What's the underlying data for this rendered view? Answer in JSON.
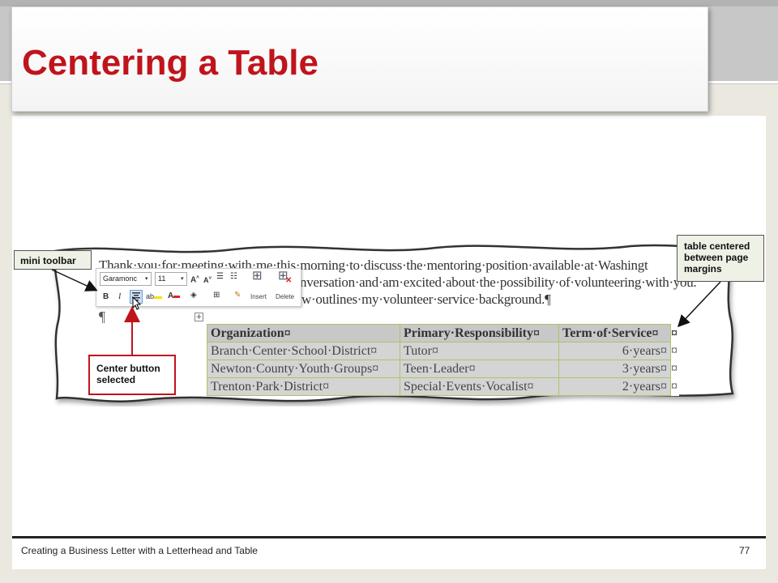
{
  "slide": {
    "title": "Centering a Table",
    "footer": "Creating a Business Letter with a Letterhead and Table",
    "page_number": "77"
  },
  "document": {
    "line1": "Thank·you·for·meeting·with·me·this·morning·to·discuss·the·mentoring·position·available·at·Washingt",
    "line2": "nversation·and·am·excited·about·the·possibility·of·volunteering·with·you.",
    "line3": "w·outlines·my·volunteer·service·background.¶",
    "pilcrow": "¶",
    "table_handle": "+",
    "table": {
      "headers": [
        "Organization¤",
        "Primary·Responsibility¤",
        "Term·of·Service¤",
        "¤"
      ],
      "rows": [
        [
          "Branch·Center·School·District¤",
          "Tutor¤",
          "6·years¤",
          "¤"
        ],
        [
          "Newton·County·Youth·Groups¤",
          "Teen·Leader¤",
          "3·years¤",
          "¤"
        ],
        [
          "Trenton·Park·District¤",
          "Special·Events·Vocalist¤",
          "2·years¤",
          "¤"
        ]
      ]
    }
  },
  "mini_toolbar": {
    "font_name": "Garamonc",
    "font_size": "11",
    "bold": "B",
    "italic": "I",
    "insert_label": "Insert",
    "delete_label": "Delete"
  },
  "callouts": {
    "mini_toolbar": "mini toolbar",
    "table_centered": "table centered between page margins",
    "center_button": "Center button selected"
  },
  "colors": {
    "title_red": "#c0141c",
    "callout_border_red": "#c0141c",
    "table_border_green": "#a9c46d"
  }
}
